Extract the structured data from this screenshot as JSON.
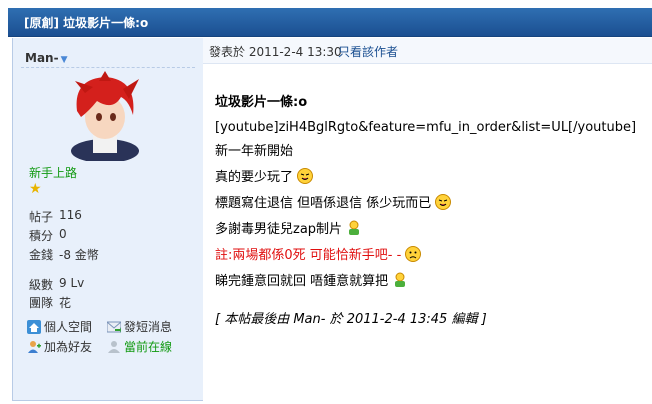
{
  "thread_title": "[原創] 垃圾影片一條:o",
  "user": {
    "name": "Man-",
    "rank": "新手上路",
    "stats": [
      {
        "label": "帖子",
        "value": "116"
      },
      {
        "label": "積分",
        "value": "0"
      },
      {
        "label": "金錢",
        "value": "-8 金幣"
      },
      {
        "label": "級數",
        "value": "9 Lv"
      },
      {
        "label": "團隊",
        "value": "花"
      }
    ],
    "links": {
      "profile": "個人空間",
      "message": "發短消息",
      "add_friend": "加為好友",
      "online": "當前在線"
    }
  },
  "meta": {
    "posted": "發表於 2011-2-4 13:30",
    "only_author": "只看該作者"
  },
  "post": {
    "title": "垃圾影片一條:o",
    "lines": [
      "[youtube]ziH4BglRgto&feature=mfu_in_order&list=UL[/youtube]",
      "新一年新開始",
      "真的要少玩了",
      "標題寫住退信 但唔係退信 係少玩而已",
      "多謝毒男徒兒zap制片",
      "註:兩場都係0死 可能恰新手吧- -",
      "睇完鍾意回就回 唔鍾意就算把"
    ],
    "edit_note": "[ 本帖最後由 Man- 於 2011-2-4 13:45 編輯 ]"
  },
  "colors": {
    "title_bar": "#1b4f91",
    "sidebar": "#e8f0fb",
    "rank": "#129a12",
    "note_red": "#e01010"
  },
  "icons": [
    "home-icon",
    "message-icon",
    "add-friend-icon",
    "online-user-icon",
    "smiley-icon",
    "sad-icon",
    "thumbs-up-icon",
    "star-icon"
  ]
}
